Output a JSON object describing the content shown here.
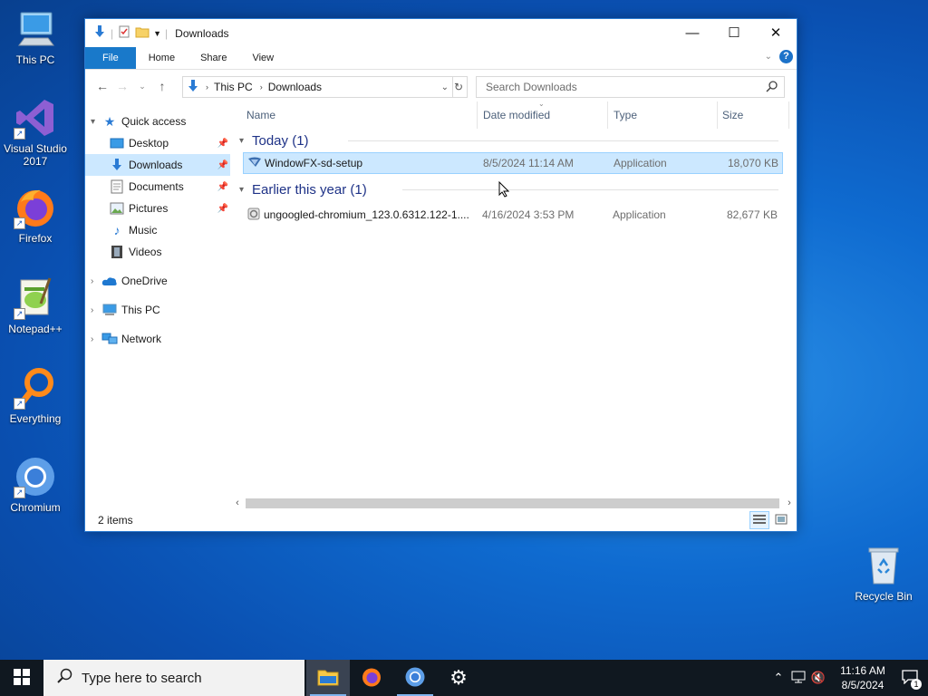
{
  "desktop": {
    "icons": [
      {
        "label": "This PC",
        "icon": "this-pc-icon"
      },
      {
        "label": "Visual Studio 2017",
        "icon": "visual-studio-icon"
      },
      {
        "label": "Firefox",
        "icon": "firefox-icon"
      },
      {
        "label": "Notepad++",
        "icon": "notepad-plus-plus-icon"
      },
      {
        "label": "Everything",
        "icon": "everything-icon"
      },
      {
        "label": "Chromium",
        "icon": "chromium-icon"
      },
      {
        "label": "Recycle Bin",
        "icon": "recycle-bin-icon"
      }
    ]
  },
  "window": {
    "title": "Downloads",
    "ribbon_tabs": [
      "File",
      "Home",
      "Share",
      "View"
    ],
    "help": "?",
    "address": {
      "crumbs": [
        "This PC",
        "Downloads"
      ]
    },
    "search": {
      "placeholder": "Search Downloads"
    },
    "nav_pane": {
      "quick_access": "Quick access",
      "pinned": [
        "Desktop",
        "Downloads",
        "Documents",
        "Pictures"
      ],
      "unpinned": [
        "Music",
        "Videos"
      ],
      "roots": [
        "OneDrive",
        "This PC",
        "Network"
      ],
      "selected": "Downloads"
    },
    "columns": [
      "Name",
      "Date modified",
      "Type",
      "Size"
    ],
    "groups": [
      {
        "label": "Today (1)",
        "files": [
          {
            "name": "WindowFX-sd-setup",
            "date": "8/5/2024 11:14 AM",
            "type": "Application",
            "size": "18,070 KB",
            "selected": true
          }
        ]
      },
      {
        "label": "Earlier this year (1)",
        "files": [
          {
            "name": "ungoogled-chromium_123.0.6312.122-1....",
            "date": "4/16/2024 3:53 PM",
            "type": "Application",
            "size": "82,677 KB",
            "selected": false
          }
        ]
      }
    ],
    "status": {
      "item_count": "2 items"
    }
  },
  "taskbar": {
    "search_placeholder": "Type here to search",
    "pinned": [
      "file-explorer-icon",
      "firefox-icon",
      "chromium-icon",
      "settings-icon"
    ],
    "clock": {
      "time": "11:16 AM",
      "date": "8/5/2024"
    },
    "notification_count": "1"
  },
  "colors": {
    "selection": "#cce8ff",
    "accent": "#1979ca",
    "group_header": "#1e3287"
  }
}
